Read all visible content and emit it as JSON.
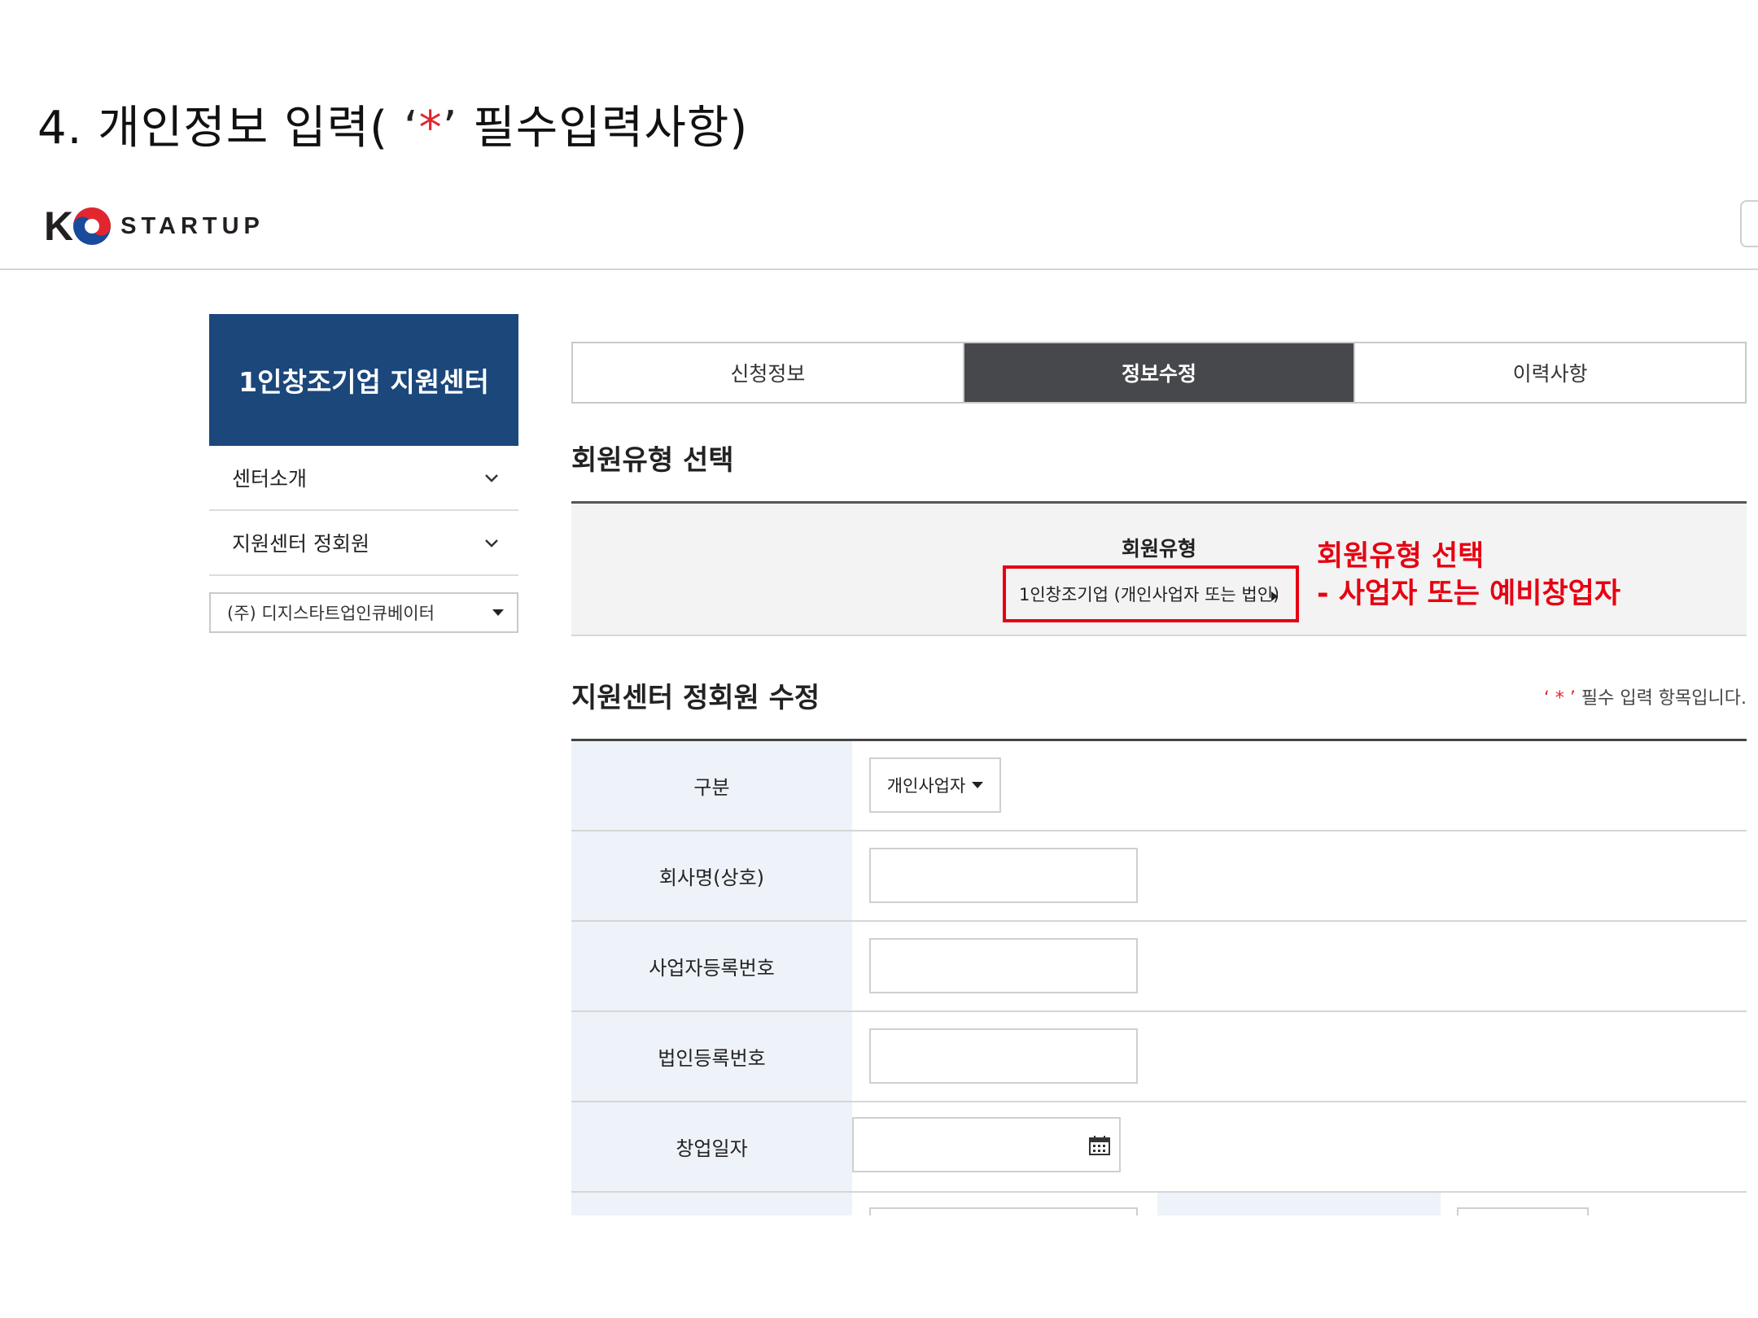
{
  "slide": {
    "title_prefix": "4. 개인정보 입력( ",
    "title_quote_open": "‘",
    "title_star": "*",
    "title_quote_close": "’",
    "title_suffix": " 필수입력사항)"
  },
  "header": {
    "logo_k": "K",
    "logo_text": "STARTUP"
  },
  "sidebar": {
    "banner_title": "1인창조기업 지원센터",
    "items": [
      {
        "label": "센터소개",
        "icon": "chevron-down-icon"
      },
      {
        "label": "지원센터 정회원",
        "icon": "chevron-down-icon"
      }
    ],
    "center_select": "(주) 디지스타트업인큐베이터"
  },
  "tabs": [
    {
      "label": "신청정보",
      "active": false
    },
    {
      "label": "정보수정",
      "active": true
    },
    {
      "label": "이력사항",
      "active": false
    }
  ],
  "member_type": {
    "section_title": "회원유형 선택",
    "label": "회원유형",
    "selected": "1인창조기업 (개인사업자 또는 법인)",
    "annotation_line1": "회원유형 선택",
    "annotation_line2": "- 사업자 또는 예비창업자",
    "annotation_color": "#e60012"
  },
  "edit": {
    "section_title": "지원센터 정회원 수정",
    "required_note_star": "‘ * ’",
    "required_note": " 필수 입력 항목입니다.",
    "rows": [
      {
        "label": "구분",
        "type": "select",
        "value": "개인사업자"
      },
      {
        "label": "회사명(상호)",
        "type": "text",
        "value": ""
      },
      {
        "label": "사업자등록번호",
        "type": "text",
        "value": ""
      },
      {
        "label": "법인등록번호",
        "type": "text",
        "value": ""
      },
      {
        "label": "창업일자",
        "type": "date",
        "value": "",
        "icon": "calendar-icon"
      }
    ]
  },
  "colors": {
    "sidebar_banner": "#1b477b",
    "active_tab": "#47484c",
    "label_bg": "#eef3f9",
    "highlight": "#e60012"
  }
}
